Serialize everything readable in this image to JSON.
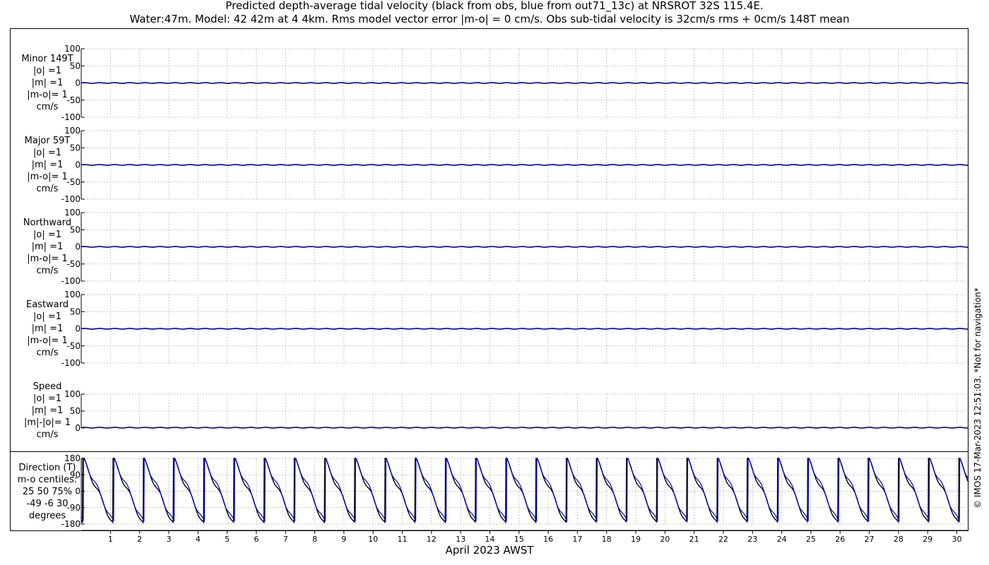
{
  "figure": {
    "title_line1": "Predicted depth-average tidal velocity (black from obs, blue from out71_13c) at NRSROT 32S 115.4E.",
    "title_line2": "Water:47m. Model: 42 42m at 4 4km. Rms model vector error |m-o| = 0 cm/s. Obs sub-tidal velocity is 32cm/s rms + 0cm/s 148T mean",
    "xlabel": "April 2023 AWST",
    "copyright": "© IMOS 17-Mar-2023 12:51:03. *Not for navigation*",
    "colors": {
      "obs": "#000000",
      "model": "#0000cc",
      "grid": "#9a9a9a"
    }
  },
  "chart_data": [
    {
      "type": "line",
      "name": "minor",
      "label_lines": [
        "Minor 149T",
        "|o| =1",
        "|m| =1",
        "|m-o|= 1",
        "cm/s"
      ],
      "ylim": [
        -100,
        100
      ],
      "yticks": [
        100,
        50,
        0,
        -50,
        -100
      ],
      "xlim": [
        0,
        30.4
      ],
      "xticks": [
        1,
        2,
        3,
        4,
        5,
        6,
        7,
        8,
        9,
        10,
        11,
        12,
        13,
        14,
        15,
        16,
        17,
        18,
        19,
        20,
        21,
        22,
        23,
        24,
        25,
        26,
        27,
        28,
        29,
        30
      ],
      "grid": true,
      "series": [
        {
          "color": "#000000",
          "level": 0,
          "amplitude": 1
        },
        {
          "color": "#0000cc",
          "level": 0,
          "amplitude": 1
        }
      ]
    },
    {
      "type": "line",
      "name": "major",
      "label_lines": [
        "Major 59T",
        "|o| =1",
        "|m| =1",
        "|m-o|= 1",
        "cm/s"
      ],
      "ylim": [
        -100,
        100
      ],
      "yticks": [
        100,
        50,
        0,
        -50,
        -100
      ],
      "xlim": [
        0,
        30.4
      ],
      "xticks": [
        1,
        2,
        3,
        4,
        5,
        6,
        7,
        8,
        9,
        10,
        11,
        12,
        13,
        14,
        15,
        16,
        17,
        18,
        19,
        20,
        21,
        22,
        23,
        24,
        25,
        26,
        27,
        28,
        29,
        30
      ],
      "grid": true,
      "series": [
        {
          "color": "#000000",
          "level": 0,
          "amplitude": 1
        },
        {
          "color": "#0000cc",
          "level": 0,
          "amplitude": 1
        }
      ]
    },
    {
      "type": "line",
      "name": "northward",
      "label_lines": [
        "Northward",
        "|o| =1",
        "|m| =1",
        "|m-o|= 1",
        "cm/s"
      ],
      "ylim": [
        -100,
        100
      ],
      "yticks": [
        100,
        50,
        0,
        -50,
        -100
      ],
      "xlim": [
        0,
        30.4
      ],
      "xticks": [
        1,
        2,
        3,
        4,
        5,
        6,
        7,
        8,
        9,
        10,
        11,
        12,
        13,
        14,
        15,
        16,
        17,
        18,
        19,
        20,
        21,
        22,
        23,
        24,
        25,
        26,
        27,
        28,
        29,
        30
      ],
      "grid": true,
      "series": [
        {
          "color": "#000000",
          "level": 0,
          "amplitude": 1
        },
        {
          "color": "#0000cc",
          "level": 0,
          "amplitude": 1
        }
      ]
    },
    {
      "type": "line",
      "name": "eastward",
      "label_lines": [
        "Eastward",
        "|o| =1",
        "|m| =1",
        "|m-o|= 1",
        "cm/s"
      ],
      "ylim": [
        -100,
        100
      ],
      "yticks": [
        100,
        50,
        0,
        -50,
        -100
      ],
      "xlim": [
        0,
        30.4
      ],
      "xticks": [
        1,
        2,
        3,
        4,
        5,
        6,
        7,
        8,
        9,
        10,
        11,
        12,
        13,
        14,
        15,
        16,
        17,
        18,
        19,
        20,
        21,
        22,
        23,
        24,
        25,
        26,
        27,
        28,
        29,
        30
      ],
      "grid": true,
      "series": [
        {
          "color": "#000000",
          "level": 0,
          "amplitude": 1
        },
        {
          "color": "#0000cc",
          "level": 0,
          "amplitude": 1
        }
      ]
    },
    {
      "type": "line",
      "name": "speed",
      "label_lines": [
        "Speed",
        "|o| =1",
        "|m| =1",
        "|m|-|o|= 1",
        "cm/s"
      ],
      "ylim": [
        0,
        100
      ],
      "yticks": [
        100,
        50,
        0
      ],
      "xlim": [
        0,
        30.4
      ],
      "xticks": [
        1,
        2,
        3,
        4,
        5,
        6,
        7,
        8,
        9,
        10,
        11,
        12,
        13,
        14,
        15,
        16,
        17,
        18,
        19,
        20,
        21,
        22,
        23,
        24,
        25,
        26,
        27,
        28,
        29,
        30
      ],
      "grid": true,
      "series": [
        {
          "color": "#000000",
          "level": 1,
          "amplitude": 1
        },
        {
          "color": "#0000cc",
          "level": 1,
          "amplitude": 1
        }
      ]
    },
    {
      "type": "line",
      "name": "direction",
      "label_lines": [
        "Direction (T)",
        "m-o centiles:",
        "25  50  75%",
        "-49  -6  30",
        "degrees"
      ],
      "ylim": [
        -180,
        180
      ],
      "yticks": [
        180,
        90,
        0,
        -90,
        -180
      ],
      "xlim": [
        0,
        30.4
      ],
      "xticks": [
        1,
        2,
        3,
        4,
        5,
        6,
        7,
        8,
        9,
        10,
        11,
        12,
        13,
        14,
        15,
        16,
        17,
        18,
        19,
        20,
        21,
        22,
        23,
        24,
        25,
        26,
        27,
        28,
        29,
        30
      ],
      "grid": true,
      "series": [
        {
          "color": "#000000",
          "cycle_days": 1.035,
          "phase_days": 0.05,
          "wrap_value": 180,
          "mean": -10
        },
        {
          "color": "#0000cc",
          "cycle_days": 1.035,
          "phase_days": 0.08,
          "wrap_value": 180,
          "mean": 0
        }
      ]
    }
  ]
}
